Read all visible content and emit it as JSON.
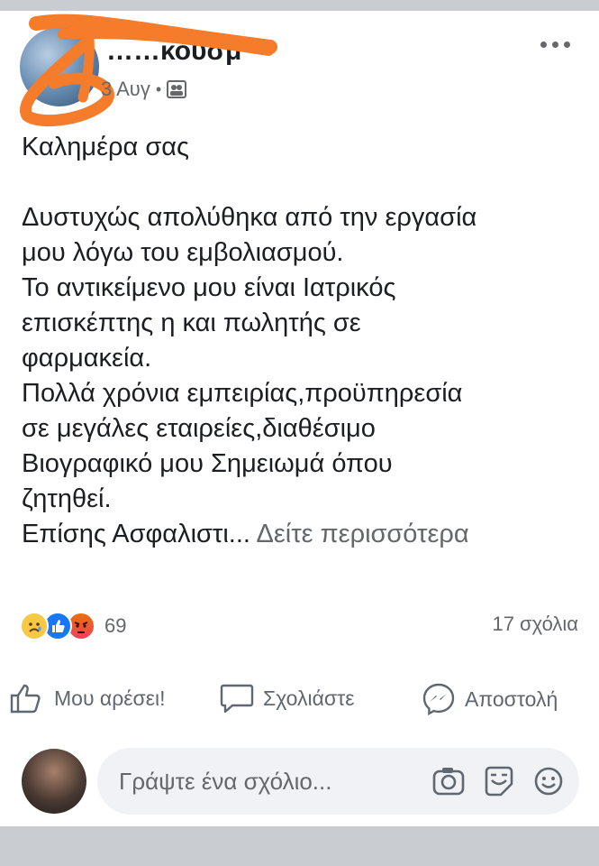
{
  "post": {
    "author_name": "……κουσμ",
    "date": "3 Αυγ",
    "meta_dot": "•",
    "body_lines": [
      "Καλημέρα σας",
      "",
      "Δυστυχώς απολύθηκα από την εργασία",
      "μου λόγω του εμβολιασμού.",
      "Το αντικείμενο μου είναι Ιατρικός",
      "επισκέπτης  η και πωλητής σε",
      "φαρμακεία.",
      "Πολλά χρόνια εμπειρίας,προϋπηρεσία",
      "σε μεγάλες εταιρείες,διαθέσιμο",
      "Βιογραφικό μου Σημειωμά όπου",
      "ζητηθεί."
    ],
    "last_line_prefix": "Επίσης Ασφαλιστι...",
    "see_more": "Δείτε περισσότερα",
    "reaction_count": "69",
    "comments_count": "17 σχόλια",
    "reaction_icons": [
      "sad-reaction-icon",
      "like-reaction-icon",
      "angry-reaction-icon"
    ]
  },
  "actions": {
    "like_label": "Μου αρέσει!",
    "comment_label": "Σχολιάστε",
    "share_label": "Αποστολή"
  },
  "comment_box": {
    "placeholder": "Γράψτε ένα σχόλιο..."
  },
  "colors": {
    "text": "#1c1e21",
    "secondary": "#65676b",
    "like_blue": "#1877f2",
    "redaction_orange": "#f57c2a"
  }
}
